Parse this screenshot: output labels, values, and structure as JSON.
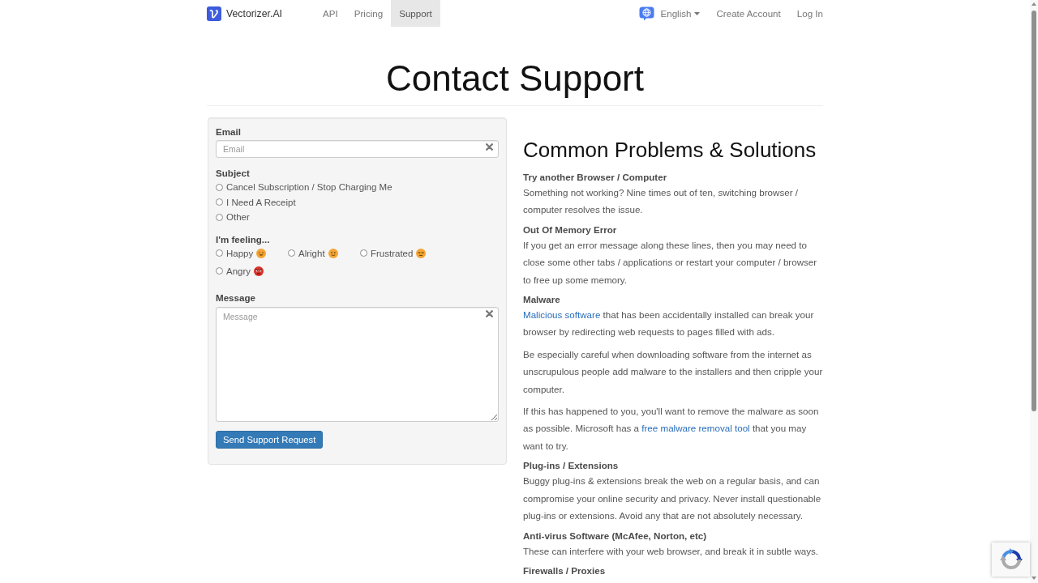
{
  "navbar": {
    "brand": "Vectorizer.AI",
    "links": [
      {
        "label": "API",
        "selected": false
      },
      {
        "label": "Pricing",
        "selected": false
      },
      {
        "label": "Support",
        "selected": true
      }
    ],
    "language": "English",
    "account_links": [
      "Create Account",
      "Log In"
    ]
  },
  "page_title": "Contact Support",
  "form": {
    "email": {
      "label": "Email",
      "placeholder": "Email"
    },
    "subject": {
      "label": "Subject",
      "options": [
        {
          "label": "Cancel Subscription / Stop Charging Me",
          "selected": false
        },
        {
          "label": "I Need A Receipt",
          "selected": false
        },
        {
          "label": "Other",
          "selected": false
        }
      ]
    },
    "feeling": {
      "label": "I'm feeling...",
      "options": [
        {
          "label": "Happy",
          "selected": false,
          "color": "#f4a535"
        },
        {
          "label": "Alright",
          "selected": false,
          "color": "#f4a535"
        },
        {
          "label": "Frustrated",
          "selected": false,
          "color": "#f4a535"
        },
        {
          "label": "Angry",
          "selected": false,
          "color": "#d9342b"
        }
      ]
    },
    "message": {
      "label": "Message",
      "placeholder": "Message"
    },
    "submit": "Send Support Request"
  },
  "help": {
    "title": "Common Problems & Solutions",
    "sections": [
      {
        "heading": "Try another Browser / Computer",
        "paragraphs": [
          [
            {
              "text": "Something not working? Nine times out of ten, switching browser / computer resolves the issue.",
              "link": false
            }
          ]
        ]
      },
      {
        "heading": "Out Of Memory Error",
        "paragraphs": [
          [
            {
              "text": "If you get an error message along these lines, then you may need to close some other tabs / applications or restart your computer / browser to free up some memory.",
              "link": false
            }
          ]
        ]
      },
      {
        "heading": "Malware",
        "paragraphs": [
          [
            {
              "text": "Malicious software",
              "link": true
            },
            {
              "text": " that has been accidentally installed can break your browser by redirecting web requests to pages filled with ads.",
              "link": false
            }
          ],
          [
            {
              "text": "Be especially careful when downloading software from the internet as unscrupulous people add malware to the installers and then cripple your computer.",
              "link": false
            }
          ],
          [
            {
              "text": "If this has happened to you, you'll want to remove the malware as soon as possible. Microsoft has a ",
              "link": false
            },
            {
              "text": "free malware removal tool",
              "link": true
            },
            {
              "text": " that you may want to try.",
              "link": false
            }
          ]
        ]
      },
      {
        "heading": "Plug-ins / Extensions",
        "paragraphs": [
          [
            {
              "text": "Buggy plug-ins & extensions break the web on a regular basis, and can compromise your online security and privacy. Never install questionable plug-ins or extensions. Avoid any that are not absolutely necessary.",
              "link": false
            }
          ]
        ]
      },
      {
        "heading": "Anti-virus Software (McAfee, Norton, etc)",
        "paragraphs": [
          [
            {
              "text": "These can interfere with your web browser, and break it in subtle ways.",
              "link": false
            }
          ]
        ]
      },
      {
        "heading": "Firewalls / Proxies"
      }
    ]
  }
}
